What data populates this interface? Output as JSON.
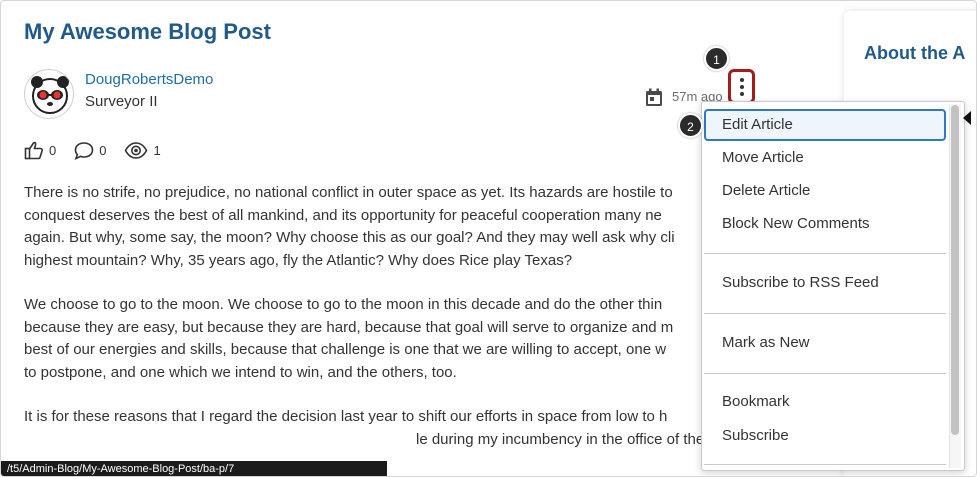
{
  "post": {
    "title": "My Awesome Blog Post",
    "author_name": "DougRobertsDemo",
    "author_role": "Surveyor II",
    "timestamp": "57m ago",
    "likes": "0",
    "comments": "0",
    "views": "1",
    "paragraphs": [
      [
        "There is no strife, no prejudice, no national conflict in outer space as yet. Its hazards are hostile to",
        "conquest deserves the best of all mankind, and its opportunity for peaceful cooperation many ne",
        "again. But why, some say, the moon? Why choose this as our goal? And they may well ask why cli",
        "highest mountain? Why, 35 years ago, fly the Atlantic? Why does Rice play Texas?"
      ],
      [
        "We choose to go to the moon. We choose to go to the moon in this decade and do the other thin",
        "because they are easy, but because they are hard, because that goal will serve to organize and m",
        "best of our energies and skills, because that challenge is one that we are willing to accept, one w",
        "to postpone, and one which we intend to win, and the others, too."
      ],
      [
        "It is for these reasons that I regard the decision last year to shift our efforts in space from low to h",
        "le during my incumbency in the office of the"
      ]
    ]
  },
  "sidebar": {
    "about_title": "About the A"
  },
  "menu": {
    "items": [
      "Edit Article",
      "Move Article",
      "Delete Article",
      "Block New Comments",
      "Subscribe to RSS Feed",
      "Mark as New",
      "Bookmark",
      "Subscribe"
    ]
  },
  "callouts": [
    "1",
    "2"
  ],
  "status_bar": {
    "url": "/t5/Admin-Blog/My-Awesome-Blog-Post/ba-p/7"
  },
  "colors": {
    "brand_blue": "#1f5a8a",
    "highlight_red": "#a51c1c",
    "focus_blue": "#2f78c2"
  }
}
